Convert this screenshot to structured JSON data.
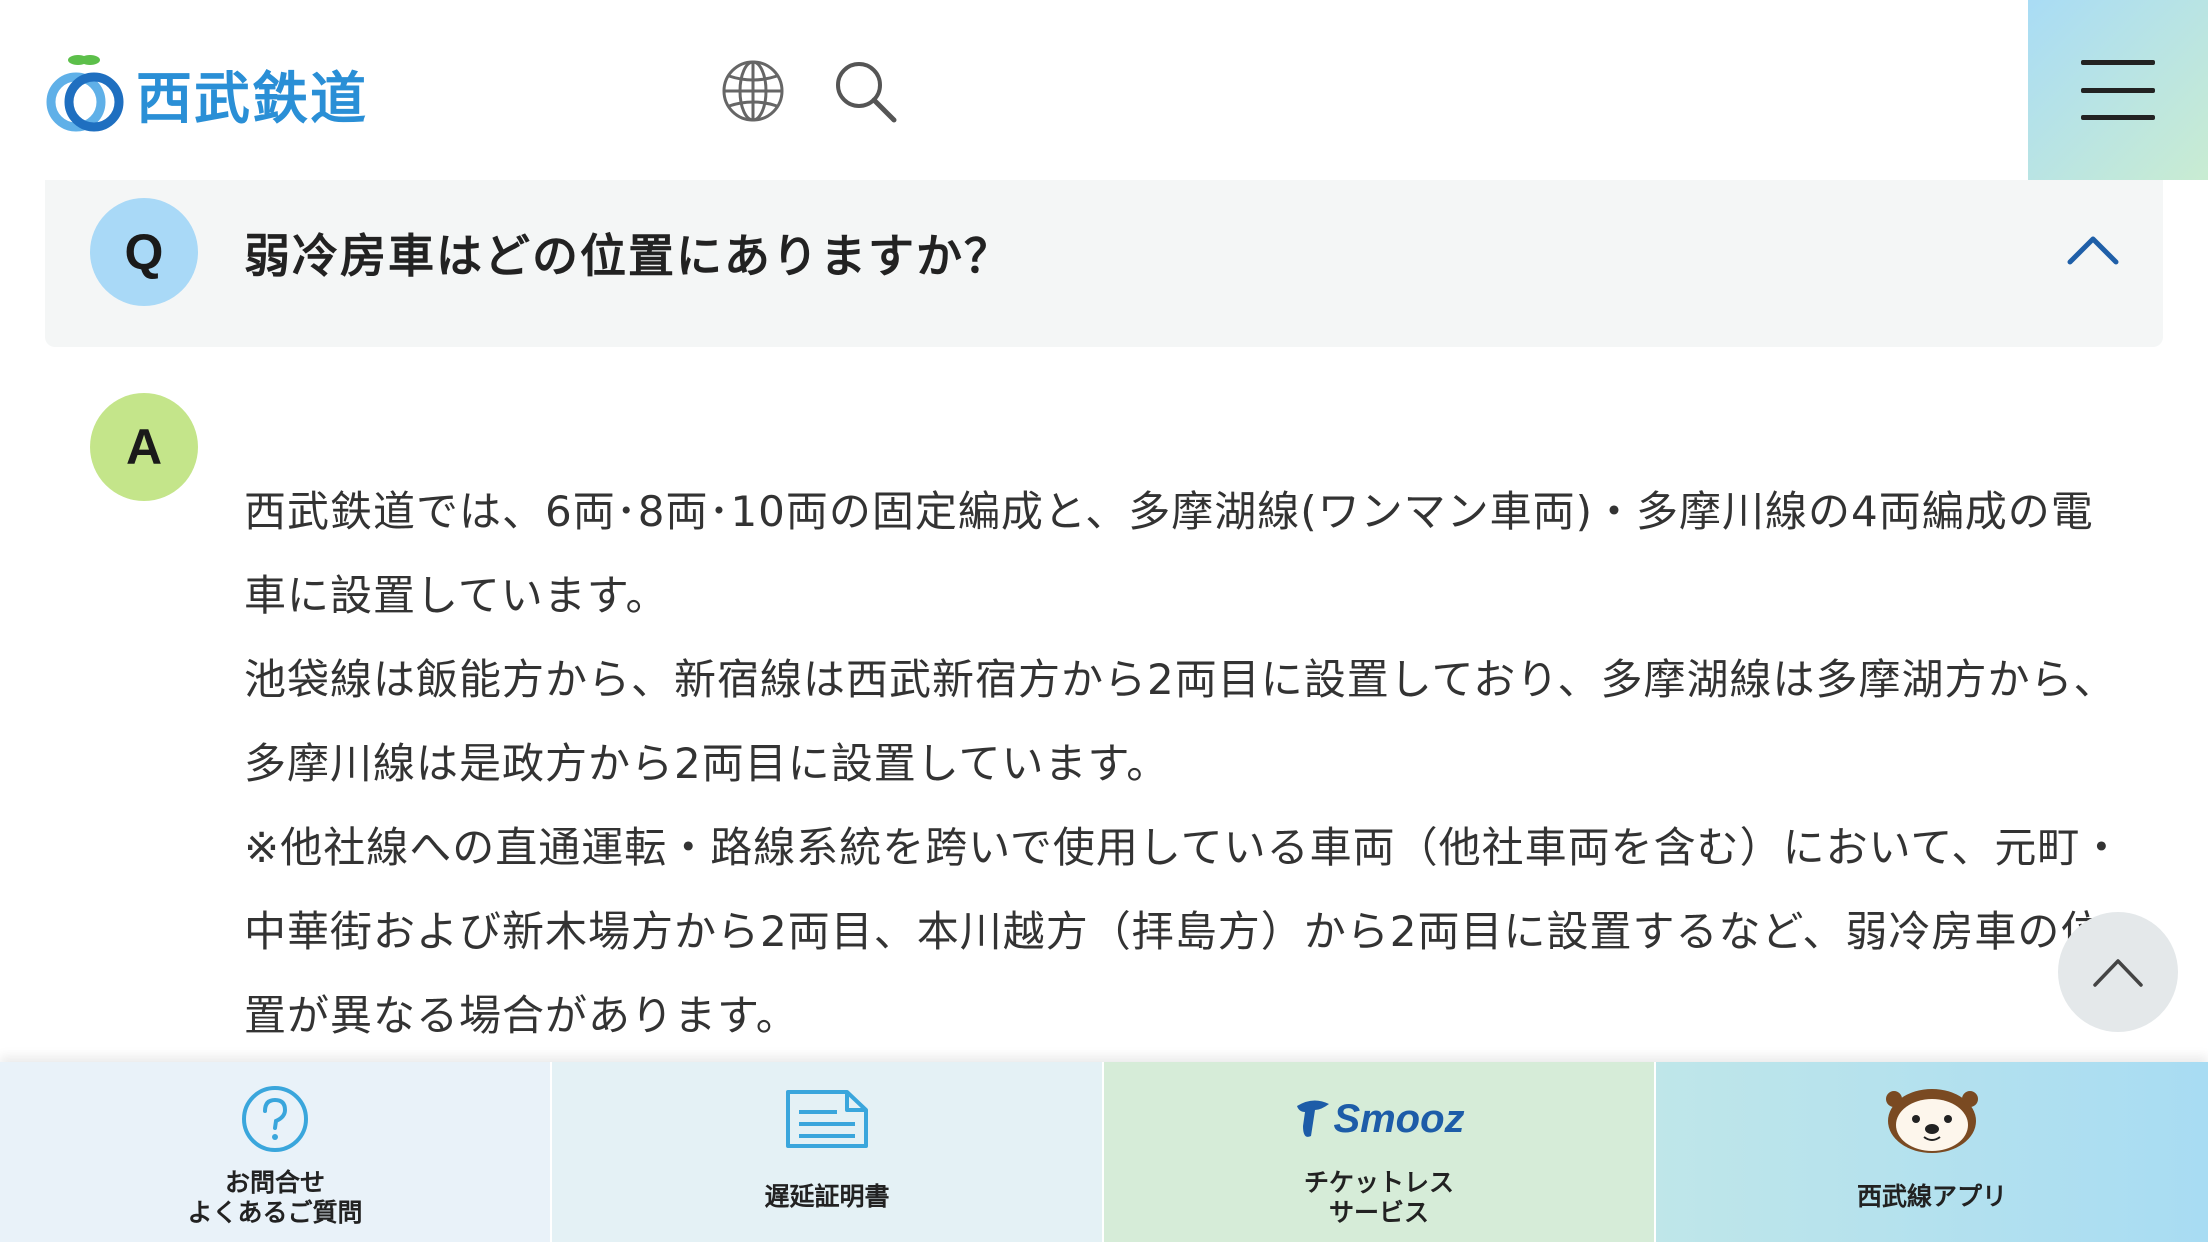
{
  "header": {
    "logo_text": "西武鉄道",
    "icons": [
      "globe-icon",
      "search-icon",
      "menu-icon"
    ],
    "menu_gradient": [
      "#a9dcf5",
      "#c9ecd2"
    ]
  },
  "faq": {
    "q_badge": "Q",
    "question": "弱冷房車はどの位置にありますか？",
    "a_badge": "A",
    "answer_paragraphs": [
      "西武鉄道では、6両･8両･10両の固定編成と、多摩湖線(ワンマン車両)・多摩川線の4両編成の電車に設置しています。",
      "池袋線は飯能方から、新宿線は西武新宿方から2両目に設置しており、多摩湖線は多摩湖方から、多摩川線は是政方から2両目に設置しています。",
      "※他社線への直通運転・路線系統を跨いで使用している車両（他社車両を含む）において、元町・中華街および新木場方から2両目、本川越方（拝島方）から2両目に設置するなど、弱冷房車の位置が異なる場合があります。"
    ]
  },
  "bottom_nav": {
    "items": [
      {
        "label": "お問合せ\nよくあるご質問",
        "icon": "question-circle-icon"
      },
      {
        "label": "遅延証明書",
        "icon": "document-icon"
      },
      {
        "label": "チケットレス\nサービス",
        "icon": "smooz-logo-icon",
        "logo_text": "Smooz"
      },
      {
        "label": "西武線アプリ",
        "icon": "otter-mascot-icon"
      }
    ]
  },
  "colors": {
    "brand_blue": "#2a8fd6",
    "q_badge": "#a9d9f7",
    "a_badge": "#c4e58a"
  }
}
